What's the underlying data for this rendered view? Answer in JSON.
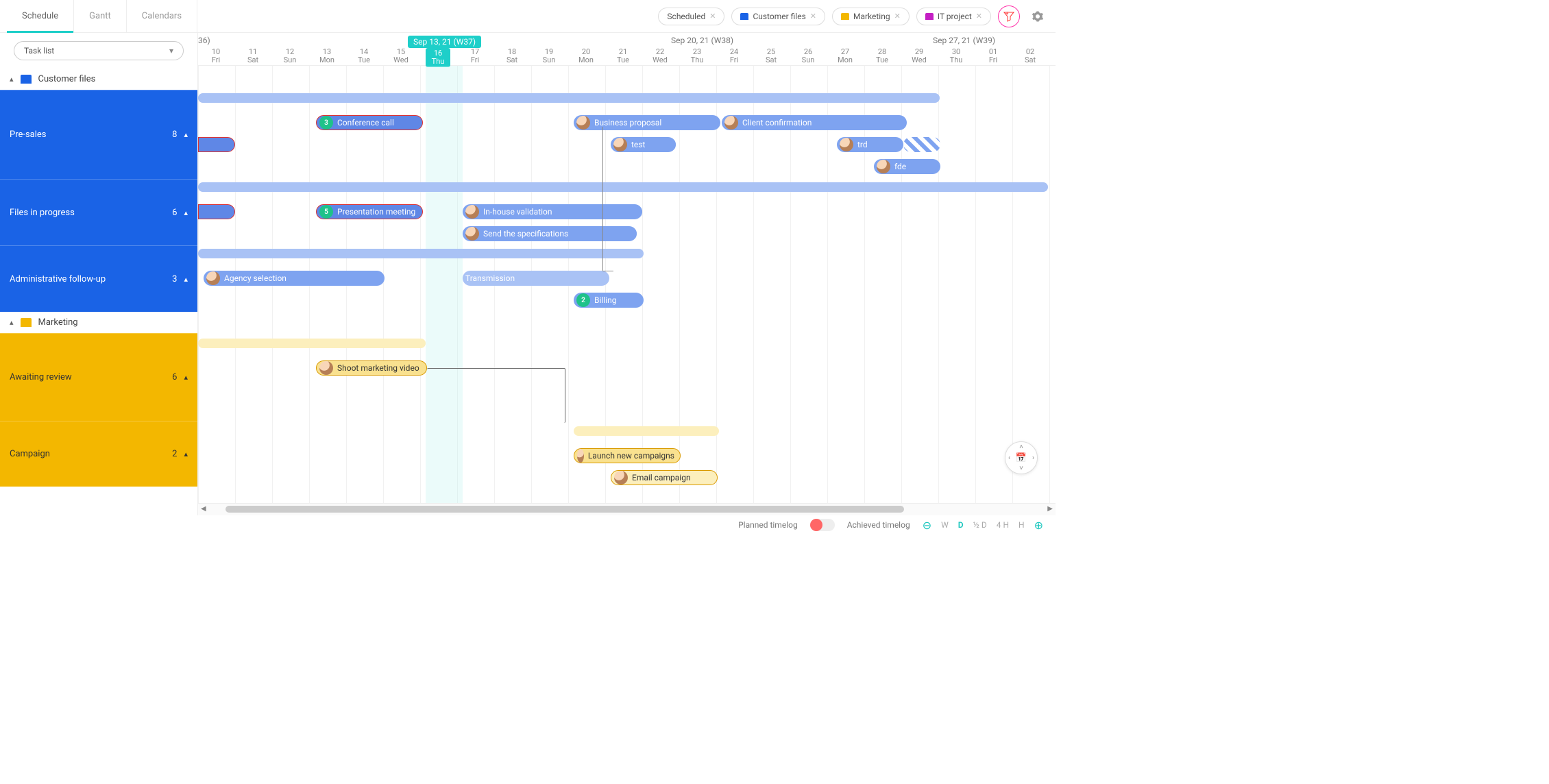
{
  "tabs": {
    "schedule": "Schedule",
    "gantt": "Gantt",
    "calendars": "Calendars"
  },
  "filters": {
    "scheduled": "Scheduled",
    "customer": "Customer files",
    "marketing": "Marketing",
    "itproject": "IT project"
  },
  "tasklist_selector": "Task list",
  "weeks": {
    "w36": "36)",
    "w37": "Sep 13, 21 (W37)",
    "w38": "Sep 20, 21 (W38)",
    "w39": "Sep 27, 21 (W39)"
  },
  "days": [
    {
      "n": "10",
      "d": "Fri"
    },
    {
      "n": "11",
      "d": "Sat"
    },
    {
      "n": "12",
      "d": "Sun"
    },
    {
      "n": "13",
      "d": "Mon"
    },
    {
      "n": "14",
      "d": "Tue"
    },
    {
      "n": "15",
      "d": "Wed"
    },
    {
      "n": "16",
      "d": "Thu"
    },
    {
      "n": "17",
      "d": "Fri"
    },
    {
      "n": "18",
      "d": "Sat"
    },
    {
      "n": "19",
      "d": "Sun"
    },
    {
      "n": "20",
      "d": "Mon"
    },
    {
      "n": "21",
      "d": "Tue"
    },
    {
      "n": "22",
      "d": "Wed"
    },
    {
      "n": "23",
      "d": "Thu"
    },
    {
      "n": "24",
      "d": "Fri"
    },
    {
      "n": "25",
      "d": "Sat"
    },
    {
      "n": "26",
      "d": "Sun"
    },
    {
      "n": "27",
      "d": "Mon"
    },
    {
      "n": "28",
      "d": "Tue"
    },
    {
      "n": "29",
      "d": "Wed"
    },
    {
      "n": "30",
      "d": "Thu"
    },
    {
      "n": "01",
      "d": "Fri"
    },
    {
      "n": "02",
      "d": "Sat"
    }
  ],
  "groups": {
    "customer": {
      "title": "Customer files",
      "color": "#1a63e6",
      "rows": [
        {
          "label": "Pre-sales",
          "count": "8"
        },
        {
          "label": "Files in progress",
          "count": "6"
        },
        {
          "label": "Administrative follow-up",
          "count": "3"
        }
      ]
    },
    "marketing": {
      "title": "Marketing",
      "color": "#f3b700",
      "rows": [
        {
          "label": "Awaiting review",
          "count": "6"
        },
        {
          "label": "Campaign",
          "count": "2"
        }
      ]
    }
  },
  "tasks": {
    "conf_call": {
      "label": "Conference call",
      "num": "3"
    },
    "biz_prop": "Business proposal",
    "client_conf": "Client confirmation",
    "test": "test",
    "trd": "trd",
    "fde": "fde",
    "pres_meet": {
      "label": "Presentation meeting",
      "num": "5"
    },
    "inhouse": "In-house validation",
    "send_spec": "Send the specifications",
    "agency": "Agency selection",
    "trans": "Transmission",
    "billing": {
      "label": "Billing",
      "num": "2"
    },
    "shoot": "Shoot marketing video",
    "launch": "Launch new campaigns",
    "email": "Email campaign"
  },
  "footer": {
    "planned": "Planned timelog",
    "achieved": "Achieved timelog",
    "zoom": {
      "w": "W",
      "d": "D",
      "halfD": "½ D",
      "h4": "4 H",
      "h": "H"
    }
  }
}
